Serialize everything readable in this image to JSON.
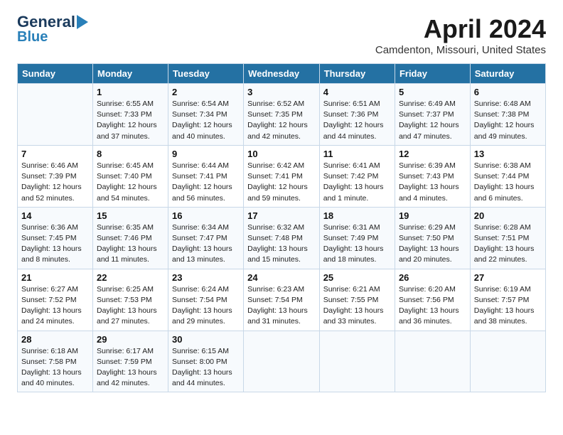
{
  "logo": {
    "line1": "General",
    "line2": "Blue"
  },
  "title": "April 2024",
  "location": "Camdenton, Missouri, United States",
  "weekdays": [
    "Sunday",
    "Monday",
    "Tuesday",
    "Wednesday",
    "Thursday",
    "Friday",
    "Saturday"
  ],
  "weeks": [
    [
      {
        "day": "",
        "detail": ""
      },
      {
        "day": "1",
        "detail": "Sunrise: 6:55 AM\nSunset: 7:33 PM\nDaylight: 12 hours\nand 37 minutes."
      },
      {
        "day": "2",
        "detail": "Sunrise: 6:54 AM\nSunset: 7:34 PM\nDaylight: 12 hours\nand 40 minutes."
      },
      {
        "day": "3",
        "detail": "Sunrise: 6:52 AM\nSunset: 7:35 PM\nDaylight: 12 hours\nand 42 minutes."
      },
      {
        "day": "4",
        "detail": "Sunrise: 6:51 AM\nSunset: 7:36 PM\nDaylight: 12 hours\nand 44 minutes."
      },
      {
        "day": "5",
        "detail": "Sunrise: 6:49 AM\nSunset: 7:37 PM\nDaylight: 12 hours\nand 47 minutes."
      },
      {
        "day": "6",
        "detail": "Sunrise: 6:48 AM\nSunset: 7:38 PM\nDaylight: 12 hours\nand 49 minutes."
      }
    ],
    [
      {
        "day": "7",
        "detail": "Sunrise: 6:46 AM\nSunset: 7:39 PM\nDaylight: 12 hours\nand 52 minutes."
      },
      {
        "day": "8",
        "detail": "Sunrise: 6:45 AM\nSunset: 7:40 PM\nDaylight: 12 hours\nand 54 minutes."
      },
      {
        "day": "9",
        "detail": "Sunrise: 6:44 AM\nSunset: 7:41 PM\nDaylight: 12 hours\nand 56 minutes."
      },
      {
        "day": "10",
        "detail": "Sunrise: 6:42 AM\nSunset: 7:41 PM\nDaylight: 12 hours\nand 59 minutes."
      },
      {
        "day": "11",
        "detail": "Sunrise: 6:41 AM\nSunset: 7:42 PM\nDaylight: 13 hours\nand 1 minute."
      },
      {
        "day": "12",
        "detail": "Sunrise: 6:39 AM\nSunset: 7:43 PM\nDaylight: 13 hours\nand 4 minutes."
      },
      {
        "day": "13",
        "detail": "Sunrise: 6:38 AM\nSunset: 7:44 PM\nDaylight: 13 hours\nand 6 minutes."
      }
    ],
    [
      {
        "day": "14",
        "detail": "Sunrise: 6:36 AM\nSunset: 7:45 PM\nDaylight: 13 hours\nand 8 minutes."
      },
      {
        "day": "15",
        "detail": "Sunrise: 6:35 AM\nSunset: 7:46 PM\nDaylight: 13 hours\nand 11 minutes."
      },
      {
        "day": "16",
        "detail": "Sunrise: 6:34 AM\nSunset: 7:47 PM\nDaylight: 13 hours\nand 13 minutes."
      },
      {
        "day": "17",
        "detail": "Sunrise: 6:32 AM\nSunset: 7:48 PM\nDaylight: 13 hours\nand 15 minutes."
      },
      {
        "day": "18",
        "detail": "Sunrise: 6:31 AM\nSunset: 7:49 PM\nDaylight: 13 hours\nand 18 minutes."
      },
      {
        "day": "19",
        "detail": "Sunrise: 6:29 AM\nSunset: 7:50 PM\nDaylight: 13 hours\nand 20 minutes."
      },
      {
        "day": "20",
        "detail": "Sunrise: 6:28 AM\nSunset: 7:51 PM\nDaylight: 13 hours\nand 22 minutes."
      }
    ],
    [
      {
        "day": "21",
        "detail": "Sunrise: 6:27 AM\nSunset: 7:52 PM\nDaylight: 13 hours\nand 24 minutes."
      },
      {
        "day": "22",
        "detail": "Sunrise: 6:25 AM\nSunset: 7:53 PM\nDaylight: 13 hours\nand 27 minutes."
      },
      {
        "day": "23",
        "detail": "Sunrise: 6:24 AM\nSunset: 7:54 PM\nDaylight: 13 hours\nand 29 minutes."
      },
      {
        "day": "24",
        "detail": "Sunrise: 6:23 AM\nSunset: 7:54 PM\nDaylight: 13 hours\nand 31 minutes."
      },
      {
        "day": "25",
        "detail": "Sunrise: 6:21 AM\nSunset: 7:55 PM\nDaylight: 13 hours\nand 33 minutes."
      },
      {
        "day": "26",
        "detail": "Sunrise: 6:20 AM\nSunset: 7:56 PM\nDaylight: 13 hours\nand 36 minutes."
      },
      {
        "day": "27",
        "detail": "Sunrise: 6:19 AM\nSunset: 7:57 PM\nDaylight: 13 hours\nand 38 minutes."
      }
    ],
    [
      {
        "day": "28",
        "detail": "Sunrise: 6:18 AM\nSunset: 7:58 PM\nDaylight: 13 hours\nand 40 minutes."
      },
      {
        "day": "29",
        "detail": "Sunrise: 6:17 AM\nSunset: 7:59 PM\nDaylight: 13 hours\nand 42 minutes."
      },
      {
        "day": "30",
        "detail": "Sunrise: 6:15 AM\nSunset: 8:00 PM\nDaylight: 13 hours\nand 44 minutes."
      },
      {
        "day": "",
        "detail": ""
      },
      {
        "day": "",
        "detail": ""
      },
      {
        "day": "",
        "detail": ""
      },
      {
        "day": "",
        "detail": ""
      }
    ]
  ]
}
